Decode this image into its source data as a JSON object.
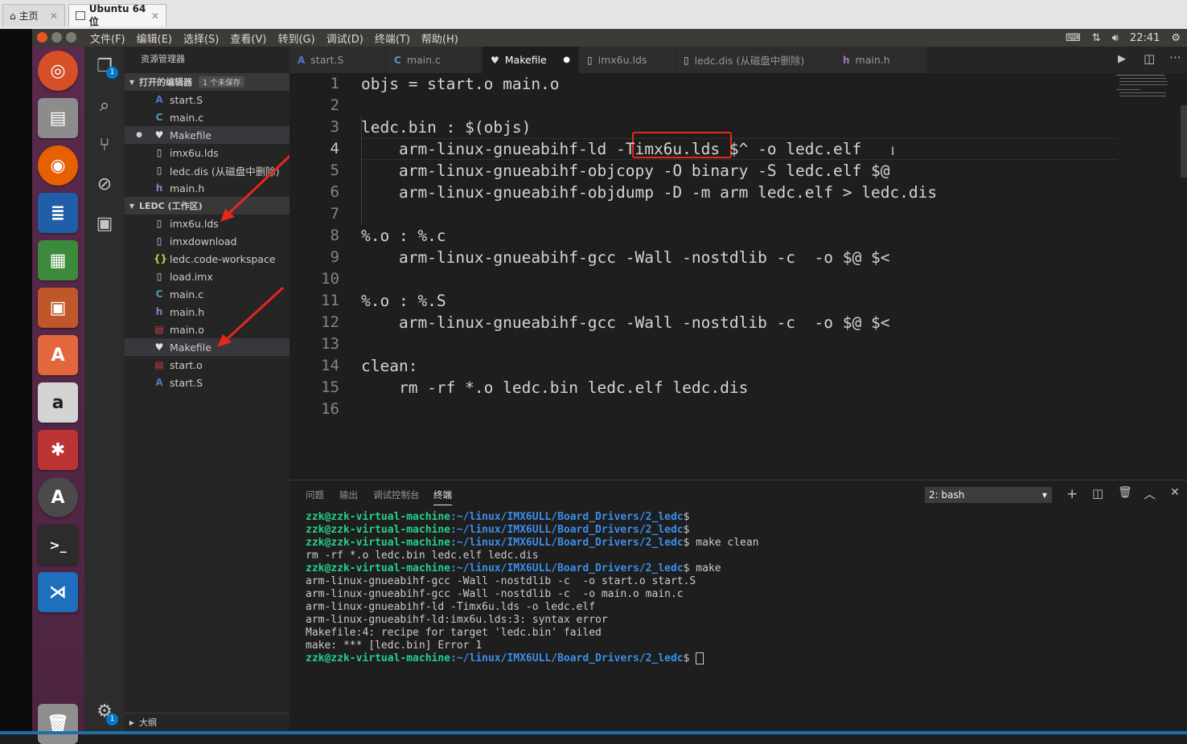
{
  "vm_tabs": {
    "home": "主页",
    "ubuntu": "Ubuntu 64 位",
    "close": "✕"
  },
  "menu": [
    "文件(F)",
    "编辑(E)",
    "选择(S)",
    "查看(V)",
    "转到(G)",
    "调试(D)",
    "终端(T)",
    "帮助(H)"
  ],
  "clock": "22:41",
  "sidebar": {
    "title": "资源管理器",
    "open_editors": "打开的编辑器",
    "unsaved_badge": "1 个未保存",
    "open_files": [
      "start.S",
      "main.c",
      "Makefile",
      "imx6u.lds",
      "ledc.dis (从磁盘中删除)",
      "main.h"
    ],
    "workspace": "LEDC (工作区)",
    "files": [
      "imx6u.lds",
      "imxdownload",
      "ledc.code-workspace",
      "load.imx",
      "main.c",
      "main.h",
      "main.o",
      "Makefile",
      "start.o",
      "start.S"
    ],
    "outline": "大纲",
    "explorer_badge": "1",
    "settings_badge": "1"
  },
  "editor_tabs": [
    "start.S",
    "main.c",
    "Makefile",
    "imx6u.lds",
    "ledc.dis (从磁盘中删除)",
    "main.h"
  ],
  "code": [
    "objs = start.o main.o",
    "",
    "ledc.bin : $(objs)",
    "    arm-linux-gnueabihf-ld -Timx6u.lds $^ -o ledc.elf",
    "    arm-linux-gnueabihf-objcopy -O binary -S ledc.elf $@",
    "    arm-linux-gnueabihf-objdump -D -m arm ledc.elf > ledc.dis",
    "",
    "%.o : %.c",
    "    arm-linux-gnueabihf-gcc -Wall -nostdlib -c  -o $@ $<",
    "",
    "%.o : %.S",
    "    arm-linux-gnueabihf-gcc -Wall -nostdlib -c  -o $@ $<",
    "",
    "clean:",
    "    rm -rf *.o ledc.bin ledc.elf ledc.dis",
    ""
  ],
  "panel": {
    "tabs": [
      "问题",
      "输出",
      "调试控制台",
      "终端"
    ],
    "terminal_select": "2: bash"
  },
  "terminal": {
    "user": "zzk@zzk-virtual-machine",
    "path": ":~/linux/IMX6ULL/Board_Drivers/2_ledc",
    "lines": [
      {
        "type": "prompt",
        "cmd": ""
      },
      {
        "type": "prompt",
        "cmd": ""
      },
      {
        "type": "prompt",
        "cmd": " make clean"
      },
      {
        "type": "out",
        "text": "rm -rf *.o ledc.bin ledc.elf ledc.dis"
      },
      {
        "type": "prompt",
        "cmd": " make"
      },
      {
        "type": "out",
        "text": "arm-linux-gnueabihf-gcc -Wall -nostdlib -c  -o start.o start.S"
      },
      {
        "type": "out",
        "text": "arm-linux-gnueabihf-gcc -Wall -nostdlib -c  -o main.o main.c"
      },
      {
        "type": "out",
        "text": "arm-linux-gnueabihf-ld -Timx6u.lds -o ledc.elf"
      },
      {
        "type": "out",
        "text": "arm-linux-gnueabihf-ld:imx6u.lds:3: syntax error"
      },
      {
        "type": "out",
        "text": "Makefile:4: recipe for target 'ledc.bin' failed"
      },
      {
        "type": "out",
        "text": "make: *** [ledc.bin] Error 1"
      },
      {
        "type": "prompt",
        "cmd": " "
      }
    ]
  }
}
